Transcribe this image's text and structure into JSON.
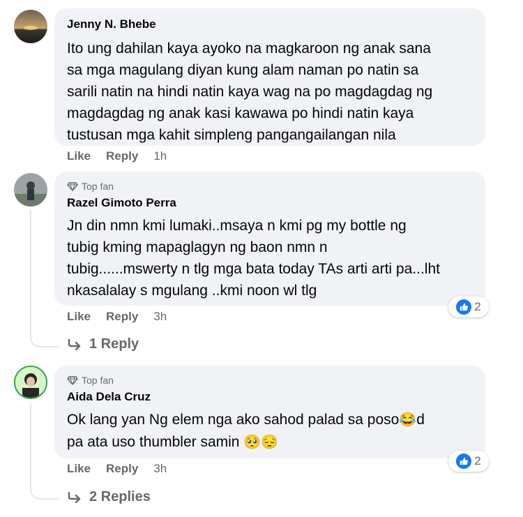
{
  "comments": [
    {
      "author": "Jenny N. Bhebe",
      "badge": "",
      "lines": [
        "Ito ung dahilan kaya ayoko na magkaroon ng anak sana",
        "sa mga magulang diyan kung alam naman po natin sa",
        "sarili natin na hindi natin kaya wag na po magdagdag ng",
        "magdagdag ng anak kasi kawawa po hindi natin kaya",
        "tustusan mga kahit simpleng pangangailangan nila"
      ],
      "like_label": "Like",
      "reply_label": "Reply",
      "time": "1h"
    },
    {
      "author": "Razel Gimoto Perra",
      "badge": "Top fan",
      "lines": [
        "Jn din nmn kmi lumaki..msaya n kmi pg my bottle ng",
        "tubig kming mapaglagyn ng baon nmn n",
        "tubig......mswerty n tlg mga bata today TAs arti arti pa...lht",
        "nkasalalay s mgulang ..kmi noon wl tlg"
      ],
      "like_label": "Like",
      "reply_label": "Reply",
      "time": "3h",
      "reaction_count": "2",
      "replies_label": "1 Reply"
    },
    {
      "author": "Aida Dela Cruz",
      "badge": "Top fan",
      "line1_before": "Ok lang yan Ng elem nga ako sahod palad sa poso",
      "line1_emoji": "😂",
      "line1_after": "d",
      "line2_text": "pa ata uso thumbler samin ",
      "line2_emojis": "🥺😔",
      "like_label": "Like",
      "reply_label": "Reply",
      "time": "3h",
      "reaction_count": "2",
      "replies_label": "2 Replies"
    }
  ],
  "colors": {
    "bubble": "#f0f2f5",
    "meta_text": "#65676b",
    "like_blue": "#1877f2"
  }
}
